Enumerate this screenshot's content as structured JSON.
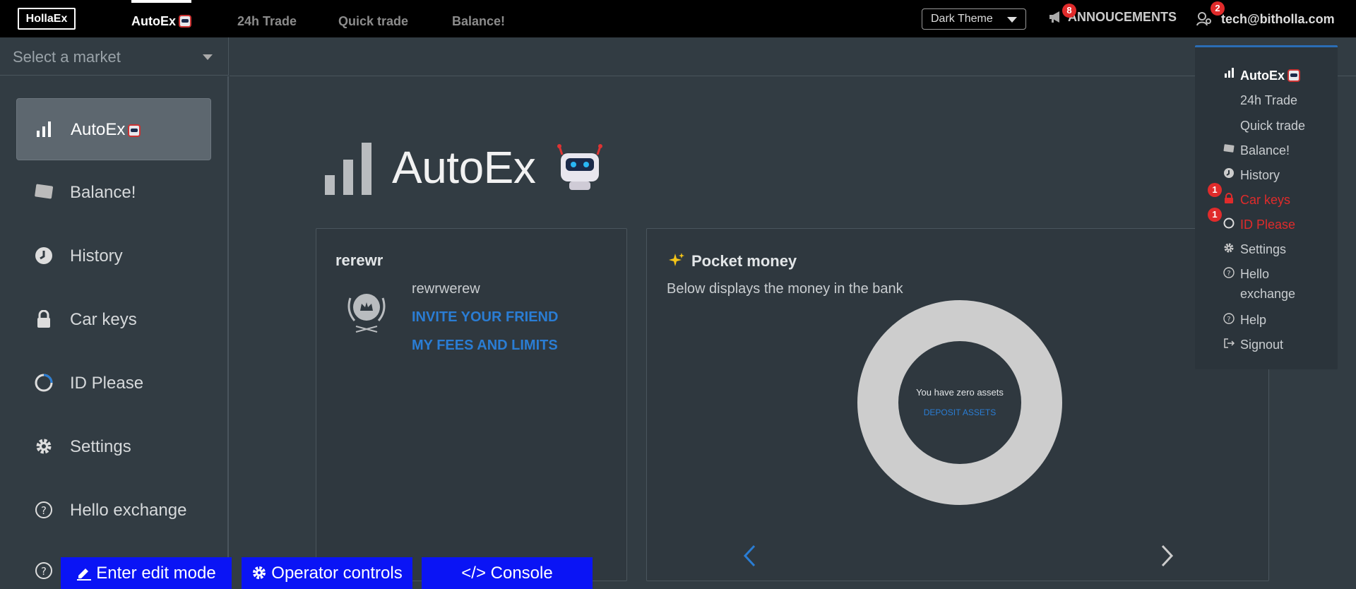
{
  "topbar": {
    "logo": "HollaEx",
    "nav": [
      {
        "label": "AutoEx"
      },
      {
        "label": "24h Trade"
      },
      {
        "label": "Quick trade"
      },
      {
        "label": "Balance!"
      }
    ],
    "theme": "Dark Theme",
    "announcements": {
      "label": "ANNOUCEMENTS",
      "count": "8"
    },
    "user": {
      "email": "tech@bitholla.com",
      "count": "2"
    }
  },
  "market": {
    "placeholder": "Select a market"
  },
  "sidebar": {
    "items": [
      {
        "label": "AutoEx",
        "icon": "bar-chart-icon"
      },
      {
        "label": "Balance!",
        "icon": "wallet-icon"
      },
      {
        "label": "History",
        "icon": "clock-icon"
      },
      {
        "label": "Car keys",
        "icon": "lock-icon"
      },
      {
        "label": "ID Please",
        "icon": "id-circle-icon"
      },
      {
        "label": "Settings",
        "icon": "gear-icon"
      },
      {
        "label": "Hello exchange",
        "icon": "help-icon"
      }
    ]
  },
  "main": {
    "title": "AutoEx",
    "profile_card": {
      "title": "rerewr",
      "username": "rewrwerew",
      "invite": "INVITE YOUR FRIEND",
      "fees": "MY FEES AND LIMITS"
    },
    "pocket_card": {
      "title": "Pocket money",
      "subtitle": "Below displays the money in the bank",
      "empty_text": "You have zero assets",
      "deposit": "DEPOSIT ASSETS"
    }
  },
  "dropdown": {
    "items": [
      {
        "label": "AutoEx"
      },
      {
        "label": "24h Trade"
      },
      {
        "label": "Quick trade"
      },
      {
        "label": "Balance!"
      },
      {
        "label": "History"
      },
      {
        "label": "Car keys",
        "badge": "1"
      },
      {
        "label": "ID Please",
        "badge": "1"
      },
      {
        "label": "Settings"
      },
      {
        "label": "Hello exchange"
      },
      {
        "label": "Help"
      },
      {
        "label": "Signout"
      }
    ]
  },
  "operator": {
    "edit": "Enter edit mode",
    "controls": "Operator controls",
    "console": "</> Console"
  },
  "colors": {
    "accent": "#2a7dd4",
    "alert": "#e02b2b",
    "operator": "#0a14f5"
  }
}
